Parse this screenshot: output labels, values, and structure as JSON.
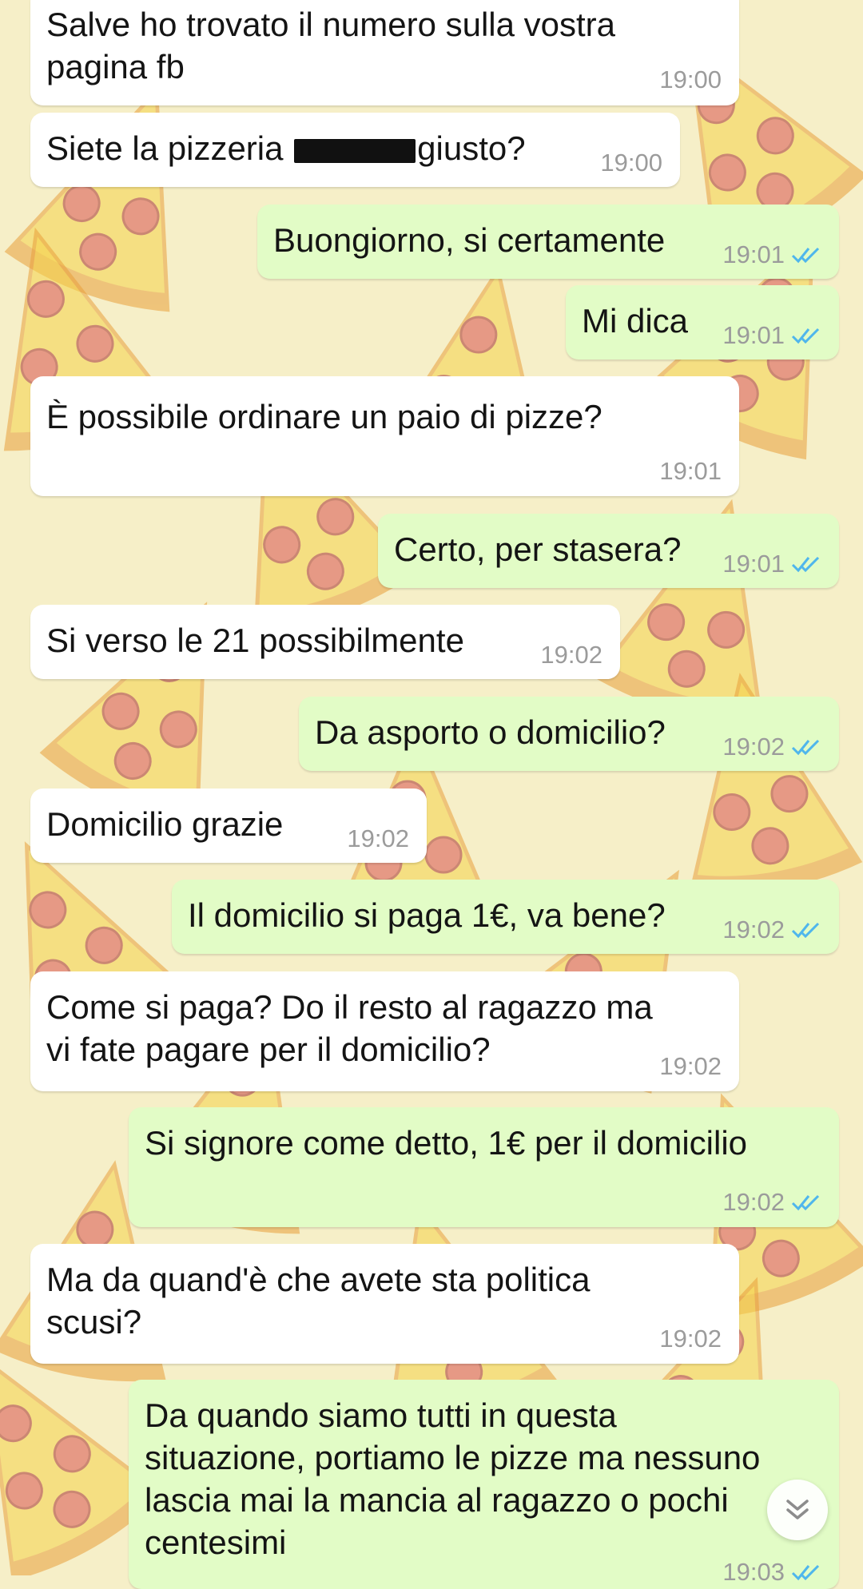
{
  "chat": {
    "messages": [
      {
        "dir": "in",
        "lines": [
          "Salve ho trovato il numero sulla vostra",
          "pagina fb"
        ],
        "time": "19:00"
      },
      {
        "dir": "in",
        "parts": [
          "Siete la pizzeria ",
          "giusto?"
        ],
        "time": "19:00",
        "redacted": true
      },
      {
        "dir": "out",
        "lines": [
          "Buongiorno, si certamente"
        ],
        "time": "19:01",
        "read": true
      },
      {
        "dir": "out",
        "lines": [
          "Mi dica"
        ],
        "time": "19:01",
        "read": true
      },
      {
        "dir": "in",
        "lines": [
          "È possibile ordinare un paio di pizze?"
        ],
        "time": "19:01"
      },
      {
        "dir": "out",
        "lines": [
          "Certo, per stasera?"
        ],
        "time": "19:01",
        "read": true
      },
      {
        "dir": "in",
        "lines": [
          "Si verso le 21 possibilmente"
        ],
        "time": "19:02"
      },
      {
        "dir": "out",
        "lines": [
          "Da asporto o domicilio?"
        ],
        "time": "19:02",
        "read": true
      },
      {
        "dir": "in",
        "lines": [
          "Domicilio grazie"
        ],
        "time": "19:02"
      },
      {
        "dir": "out",
        "lines": [
          "Il domicilio si paga 1€, va bene?"
        ],
        "time": "19:02",
        "read": true
      },
      {
        "dir": "in",
        "lines": [
          "Come si paga? Do il resto al ragazzo ma",
          "vi fate pagare per il domicilio?"
        ],
        "time": "19:02"
      },
      {
        "dir": "out",
        "lines": [
          "Si signore come detto, 1€ per il domicilio"
        ],
        "time": "19:02",
        "read": true
      },
      {
        "dir": "in",
        "lines": [
          "Ma da quand'è che avete sta politica",
          "scusi?"
        ],
        "time": "19:02"
      },
      {
        "dir": "out",
        "lines": [
          "Da quando siamo tutti in questa",
          "situazione, portiamo le pizze ma nessuno",
          "lascia mai la mancia al ragazzo o pochi",
          "centesimi"
        ],
        "time": "19:03",
        "read": true
      }
    ]
  },
  "icons": {
    "read_receipt": "double-check-icon",
    "scroll_down": "double-chevron-down-icon",
    "wallpaper": "pizza-slice-icon"
  },
  "colors": {
    "wallpaper": "#f6efc8",
    "incoming_bubble": "#ffffff",
    "outgoing_bubble": "#e2fcc6",
    "timestamp": "#9b9b9b",
    "read_tick": "#4fb6ec"
  }
}
